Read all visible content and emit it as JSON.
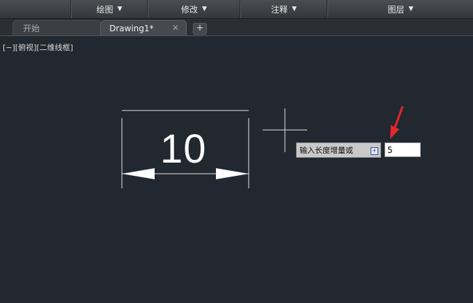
{
  "ribbon": {
    "items": [
      {
        "label": "绘图"
      },
      {
        "label": "修改"
      },
      {
        "label": "注释"
      },
      {
        "label": "图层"
      }
    ]
  },
  "tabs": {
    "start": "开始",
    "drawing": "Drawing1*",
    "close_glyph": "✕",
    "add_glyph": "+"
  },
  "viewport": {
    "label": "[−][俯视][二维线框]"
  },
  "dimension": {
    "text": "10"
  },
  "prompt": {
    "text": "输入长度增量或",
    "button_glyph": "+"
  },
  "input": {
    "value": "5"
  },
  "colors": {
    "canvas": "#212830",
    "annotation_arrow": "#e8262b"
  }
}
